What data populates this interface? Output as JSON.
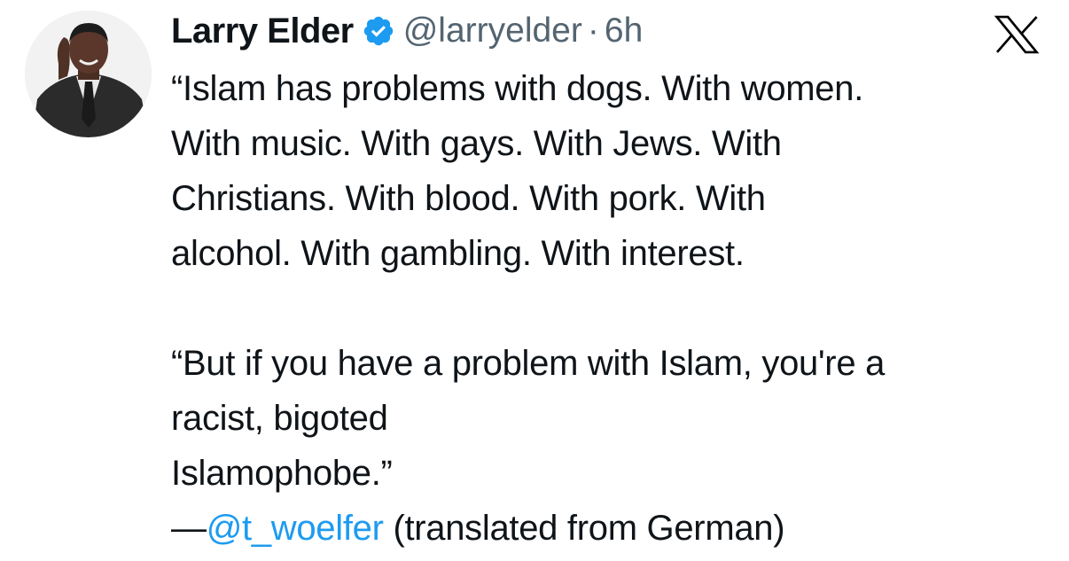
{
  "author": {
    "display_name": "Larry Elder",
    "handle": "@larryelder",
    "separator": "·",
    "time": "6h",
    "verified": true,
    "avatar_alt": "Larry Elder profile photo"
  },
  "brand": {
    "logo_icon": "x-logo-icon",
    "accent": "#1d9bf0",
    "text": "#0f1419",
    "muted": "#536471"
  },
  "tweet": {
    "paragraph1_lines": [
      "“Islam has problems with dogs. With women.",
      "With music. With gays. With Jews. With",
      "Christians. With blood. With pork. With",
      "alcohol. With gambling. With interest."
    ],
    "paragraph2_lines": [
      "“But if you have a problem with Islam, you're a",
      "racist, bigoted",
      "Islamophobe.”"
    ],
    "attribution_prefix": "—",
    "attribution_mention": "@t_woelfer",
    "attribution_suffix": " (translated from German)"
  }
}
